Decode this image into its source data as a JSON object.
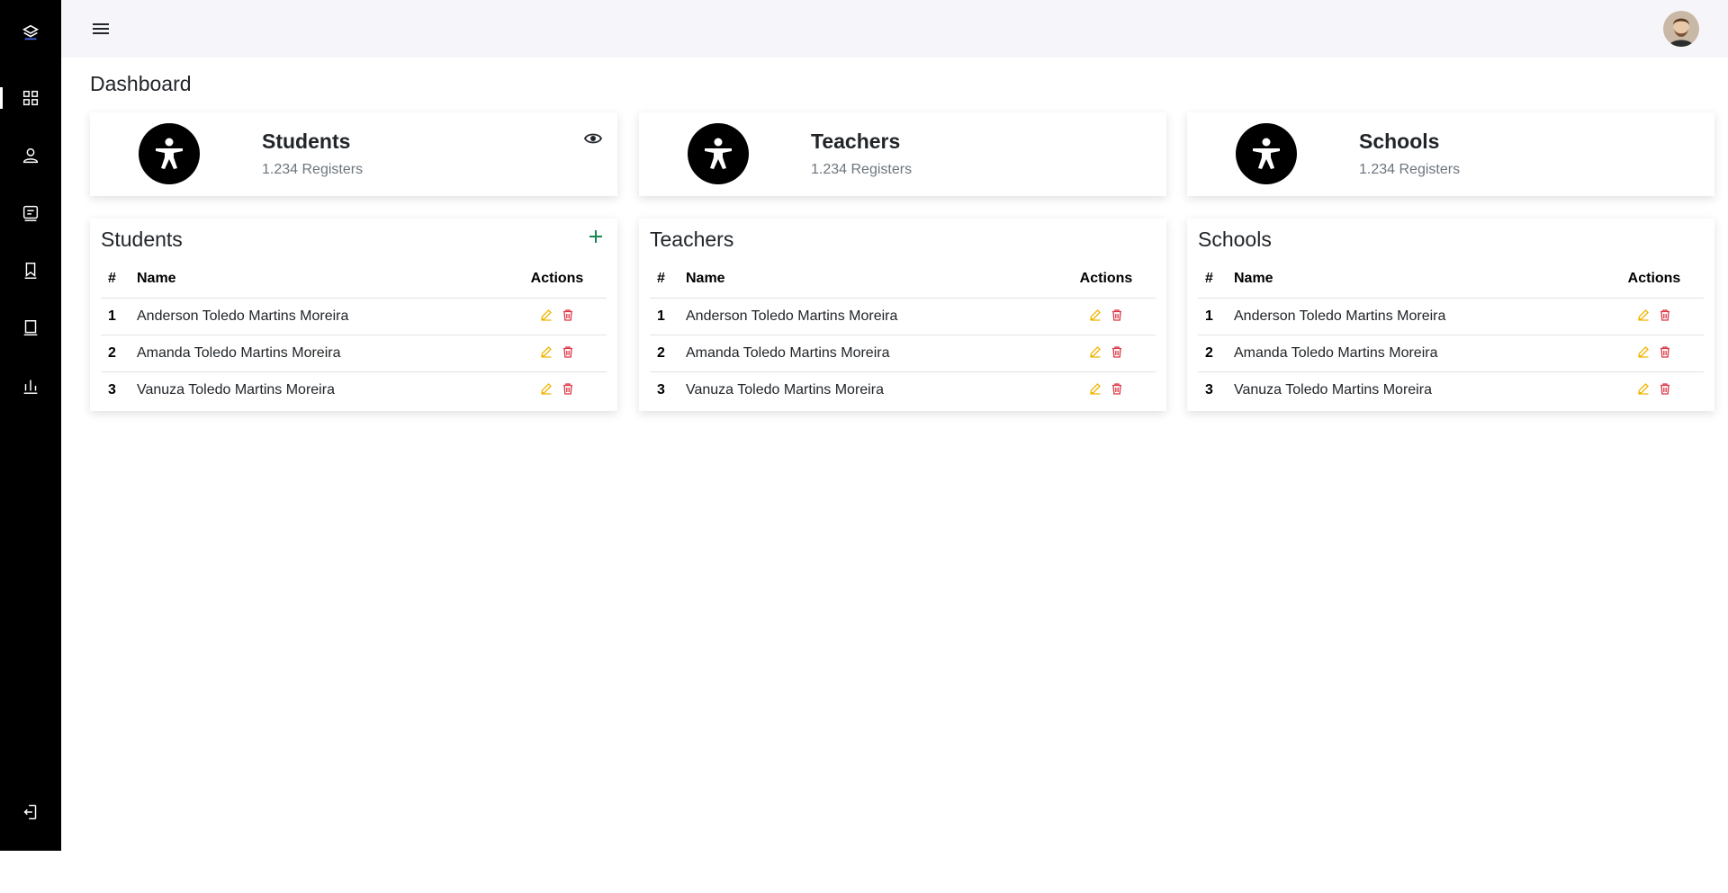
{
  "page_title": "Dashboard",
  "colors": {
    "sidebar": "#000000",
    "topbar": "#f6f6fa",
    "edit": "#f0b400",
    "delete": "#dc3545",
    "add": "#198754"
  },
  "sidebar": {
    "items": [
      {
        "icon": "layers-icon"
      },
      {
        "icon": "grid-icon"
      },
      {
        "icon": "person-icon"
      },
      {
        "icon": "card-text-icon"
      },
      {
        "icon": "bookmark-icon"
      },
      {
        "icon": "building-icon"
      },
      {
        "icon": "bar-chart-icon"
      }
    ],
    "logout_icon": "logout-icon"
  },
  "stats": [
    {
      "title": "Students",
      "sub": "1.234 Registers",
      "icon": "accessibility-icon"
    },
    {
      "title": "Teachers",
      "sub": "1.234 Registers",
      "icon": "accessibility-icon"
    },
    {
      "title": "Schools",
      "sub": "1.234 Registers",
      "icon": "accessibility-icon"
    }
  ],
  "tables": [
    {
      "title": "Students",
      "columns": [
        "#",
        "Name",
        "Actions"
      ],
      "rows": [
        {
          "num": "1",
          "name": "Anderson Toledo Martins Moreira"
        },
        {
          "num": "2",
          "name": "Amanda Toledo Martins Moreira"
        },
        {
          "num": "3",
          "name": "Vanuza Toledo Martins Moreira"
        }
      ]
    },
    {
      "title": "Teachers",
      "columns": [
        "#",
        "Name",
        "Actions"
      ],
      "rows": [
        {
          "num": "1",
          "name": "Anderson Toledo Martins Moreira"
        },
        {
          "num": "2",
          "name": "Amanda Toledo Martins Moreira"
        },
        {
          "num": "3",
          "name": "Vanuza Toledo Martins Moreira"
        }
      ]
    },
    {
      "title": "Schools",
      "columns": [
        "#",
        "Name",
        "Actions"
      ],
      "rows": [
        {
          "num": "1",
          "name": "Anderson Toledo Martins Moreira"
        },
        {
          "num": "2",
          "name": "Amanda Toledo Martins Moreira"
        },
        {
          "num": "3",
          "name": "Vanuza Toledo Martins Moreira"
        }
      ]
    }
  ]
}
